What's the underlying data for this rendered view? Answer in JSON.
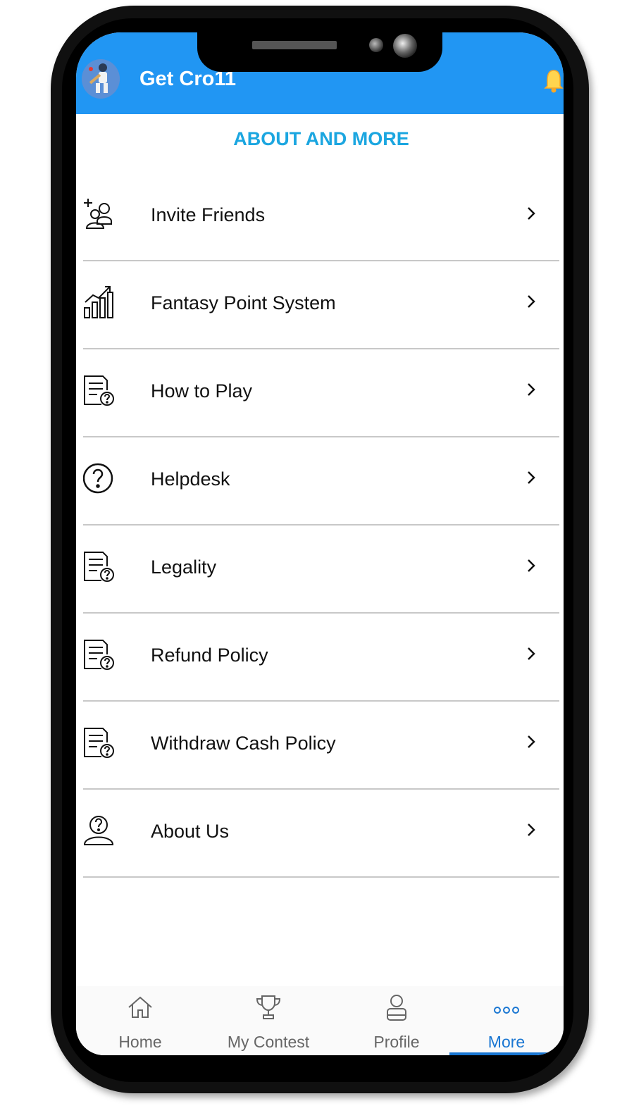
{
  "app": {
    "title": "Get Cro11"
  },
  "section": {
    "title": "ABOUT AND MORE"
  },
  "menu": {
    "items": [
      {
        "label": "Invite Friends",
        "icon": "invite-friends-icon"
      },
      {
        "label": "Fantasy Point System",
        "icon": "growth-chart-icon"
      },
      {
        "label": "How to Play",
        "icon": "document-question-icon"
      },
      {
        "label": "Helpdesk",
        "icon": "question-circle-icon"
      },
      {
        "label": "Legality",
        "icon": "document-question-icon"
      },
      {
        "label": "Refund Policy",
        "icon": "document-question-icon"
      },
      {
        "label": "Withdraw Cash Policy",
        "icon": "document-question-icon"
      },
      {
        "label": "About Us",
        "icon": "person-question-icon"
      }
    ]
  },
  "bottom_nav": {
    "items": [
      {
        "label": "Home",
        "icon": "home-icon"
      },
      {
        "label": "My Contest",
        "icon": "trophy-icon"
      },
      {
        "label": "Profile",
        "icon": "profile-icon"
      },
      {
        "label": "More",
        "icon": "more-dots-icon",
        "active": true
      }
    ]
  },
  "colors": {
    "header": "#2196f3",
    "section_title": "#1ba6e0",
    "active_nav": "#1976d2"
  }
}
